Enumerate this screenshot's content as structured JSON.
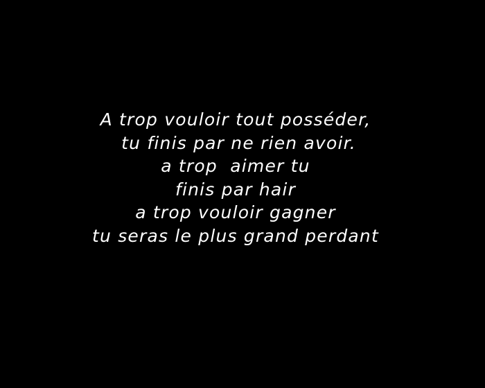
{
  "colors": {
    "background": "#000000",
    "text": "#ffffff"
  },
  "poem": {
    "lines": [
      "A trop vouloir tout posséder,",
      " tu finis par ne rien avoir.",
      "a trop  aimer tu",
      "finis par hair",
      "a trop vouloir gagner",
      "tu seras le plus grand perdant"
    ]
  }
}
